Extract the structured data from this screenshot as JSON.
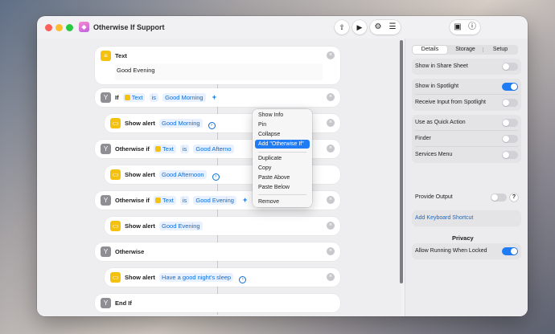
{
  "window": {
    "title": "Otherwise If Support",
    "app_icon": "shortcuts-icon"
  },
  "toolbar": {
    "share_icon": "share-icon",
    "run_icon": "play-icon",
    "settings_icon": "gear-icon",
    "library_icon": "library-icon",
    "clipboard_icon": "clipboard-icon",
    "info_icon": "info-icon"
  },
  "actions": {
    "text": {
      "title": "Text",
      "value": "Good Evening"
    },
    "if1": {
      "keyword": "If",
      "variable": "Text",
      "operator": "is",
      "value": "Good Morning",
      "plus": "+"
    },
    "alert1": {
      "keyword": "Show alert",
      "value": "Good Morning"
    },
    "if2": {
      "keyword": "Otherwise if",
      "variable": "Text",
      "operator": "is",
      "value": "Good Afterno"
    },
    "alert2": {
      "keyword": "Show alert",
      "value": "Good Afternoon"
    },
    "if3": {
      "keyword": "Otherwise if",
      "variable": "Text",
      "operator": "is",
      "value": "Good Evening",
      "plus": "+"
    },
    "alert3": {
      "keyword": "Show alert",
      "value": "Good Evening"
    },
    "otherwise": {
      "keyword": "Otherwise"
    },
    "alert4": {
      "keyword": "Show alert",
      "value": "Have a good night's sleep"
    },
    "endif": {
      "keyword": "End If"
    },
    "remove_glyph": "×",
    "chevron_glyph": "›"
  },
  "context_menu": {
    "items": [
      "Show Info",
      "Pin",
      "Collapse",
      "Add \"Otherwise If\"",
      "Duplicate",
      "Copy",
      "Paste Above",
      "Paste Below",
      "Remove"
    ],
    "highlighted_index": 3
  },
  "inspector": {
    "tabs": [
      "Details",
      "Storage",
      "Setup"
    ],
    "selected_tab": "Details",
    "group1": [
      {
        "label": "Show in Share Sheet",
        "on": false
      }
    ],
    "group2": [
      {
        "label": "Show in Spotlight",
        "on": true
      },
      {
        "label": "Receive Input from Spotlight",
        "on": false
      }
    ],
    "group3": [
      {
        "label": "Use as Quick Action",
        "on": false
      },
      {
        "label": "Finder",
        "on": false
      },
      {
        "label": "Services Menu",
        "on": false
      }
    ],
    "provide_output": {
      "label": "Provide Output",
      "on": false,
      "help": "?"
    },
    "keyboard_shortcut": "Add Keyboard Shortcut",
    "privacy": {
      "title": "Privacy",
      "row": {
        "label": "Allow Running When Locked",
        "on": true
      }
    }
  }
}
